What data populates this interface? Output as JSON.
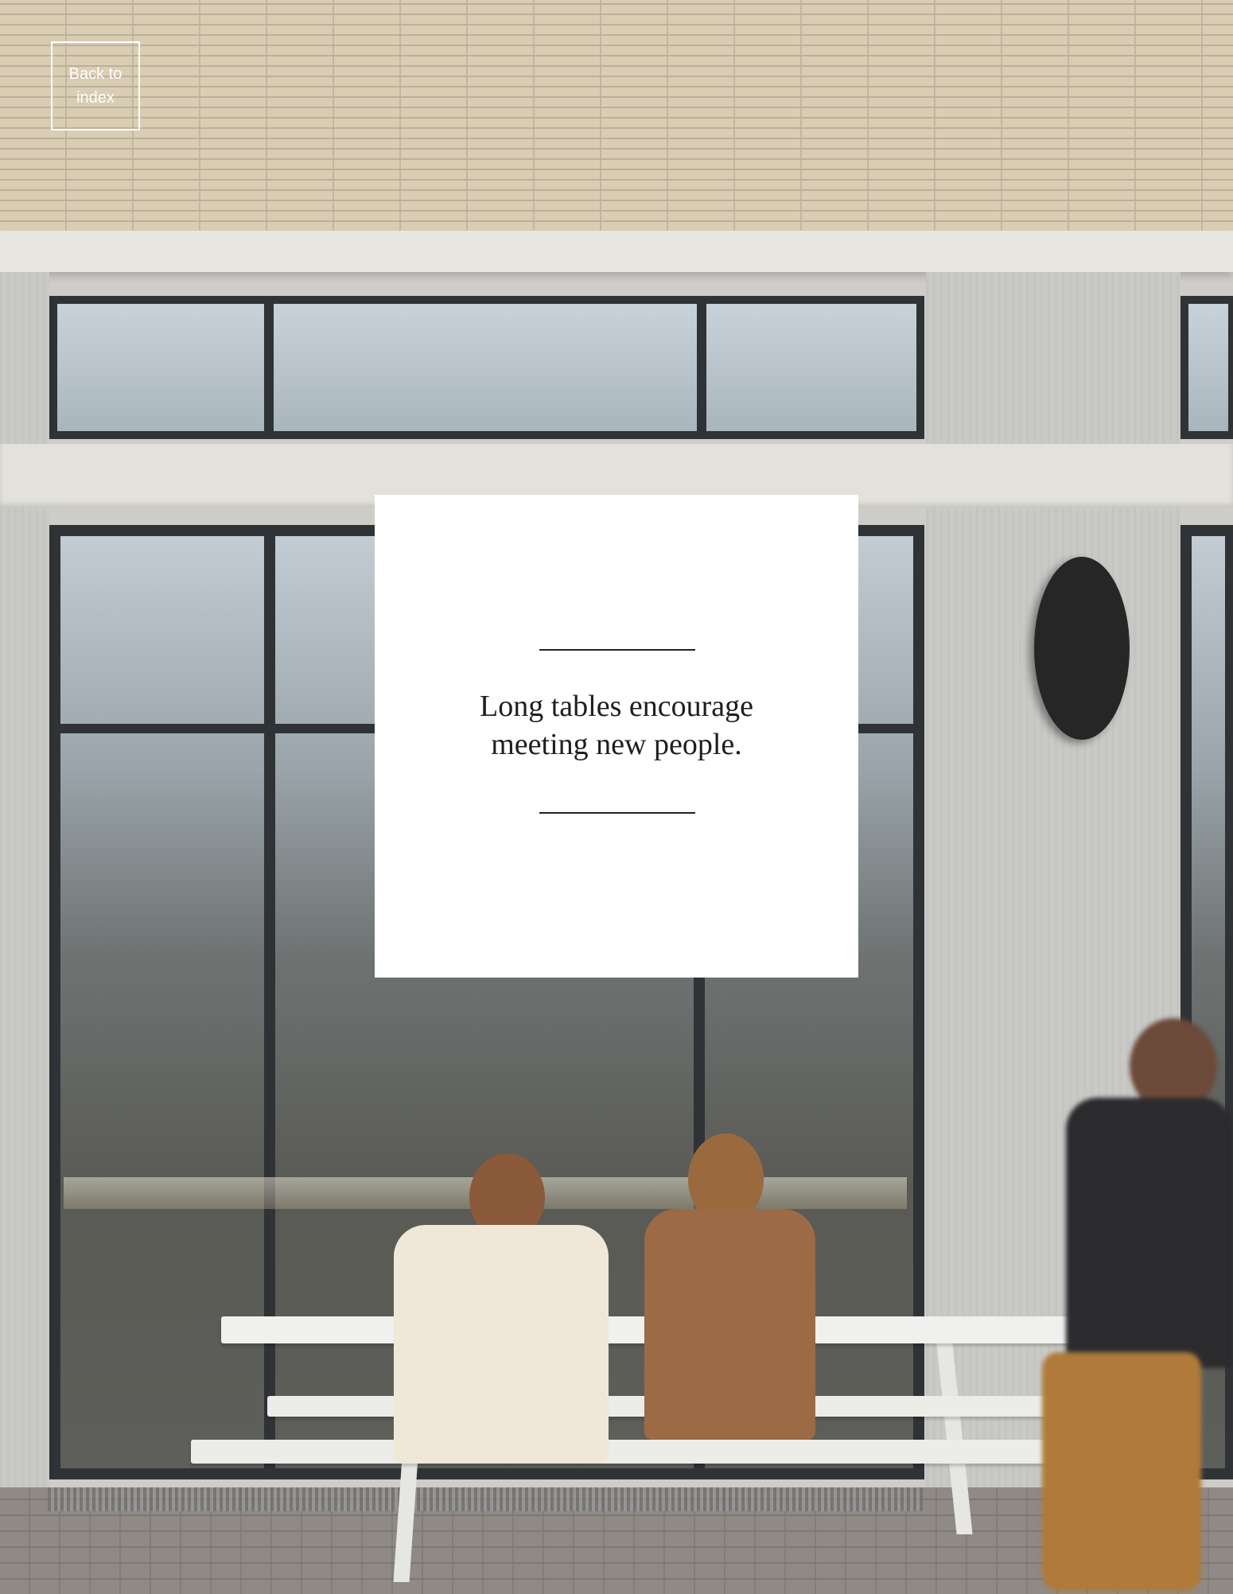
{
  "navigation": {
    "back_label": "Back to index"
  },
  "quote": {
    "text": "Long tables encourage\nmeeting new people."
  },
  "colors": {
    "card_background": "#ffffff",
    "quote_text": "#1e1e1e",
    "rule": "#222222",
    "button_border": "#ffffff"
  }
}
